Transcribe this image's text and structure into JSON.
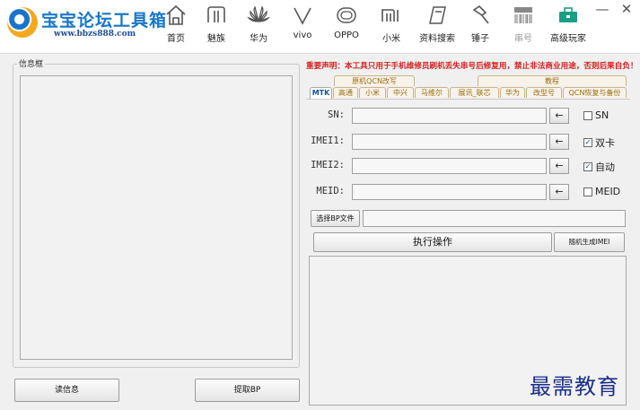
{
  "app": {
    "logo_title": "宝宝论坛工具箱",
    "logo_url": "www.bbzs888.com"
  },
  "nav": [
    {
      "label": "首页",
      "icon": "home-icon"
    },
    {
      "label": "魅族",
      "icon": "meizu-icon"
    },
    {
      "label": "华为",
      "icon": "huawei-icon"
    },
    {
      "label": "vivo",
      "icon": "vivo-icon"
    },
    {
      "label": "OPPO",
      "icon": "oppo-icon"
    },
    {
      "label": "小米",
      "icon": "xiaomi-icon"
    },
    {
      "label": "资料搜索",
      "icon": "search-docs-icon"
    },
    {
      "label": "锤子",
      "icon": "hammer-icon"
    },
    {
      "label": "串号",
      "icon": "imei-icon"
    },
    {
      "label": "高级玩家",
      "icon": "toolbox-icon"
    }
  ],
  "window": {
    "minimize": "—",
    "close": "✕"
  },
  "left": {
    "info_legend": "信息框",
    "read_button": "读信息",
    "extract_button": "提取BP"
  },
  "notice": "重要声明：本工具只用于手机维修员刷机丢失串号后修复用，禁止非法商业用途，否则后果自负！",
  "tabs_top": [
    {
      "label": "原机QCN改写"
    },
    {
      "label": "教程"
    }
  ],
  "tabs": [
    {
      "label": "MTK",
      "active": true
    },
    {
      "label": "高通",
      "active": false
    },
    {
      "label": "小米",
      "active": false
    },
    {
      "label": "中兴",
      "active": false
    },
    {
      "label": "马维尔",
      "active": false
    },
    {
      "label": "展讯_联芯",
      "active": false
    },
    {
      "label": "华为",
      "active": false
    },
    {
      "label": "改型号",
      "active": false
    },
    {
      "label": "QCN恢复与备份",
      "active": false
    }
  ],
  "fields": [
    {
      "label": "SN:",
      "value": "",
      "arrow": "←",
      "check_label": "SN",
      "checked": false
    },
    {
      "label": "IMEI1:",
      "value": "",
      "arrow": "←",
      "check_label": "双卡",
      "checked": true
    },
    {
      "label": "IMEI2:",
      "value": "",
      "arrow": "←",
      "check_label": "自动",
      "checked": true
    },
    {
      "label": "MEID:",
      "value": "",
      "arrow": "←",
      "check_label": "MEID",
      "checked": false
    }
  ],
  "bp": {
    "select_button": "选择BP文件",
    "path": ""
  },
  "actions": {
    "execute": "执行操作",
    "random_imei": "随机生成IMEI"
  },
  "watermark": "最需教育",
  "colors": {
    "notice": "#d42020",
    "brand": "#1877c5",
    "tab_active": "#1c4f9b",
    "tab_text": "#9a6d10"
  }
}
